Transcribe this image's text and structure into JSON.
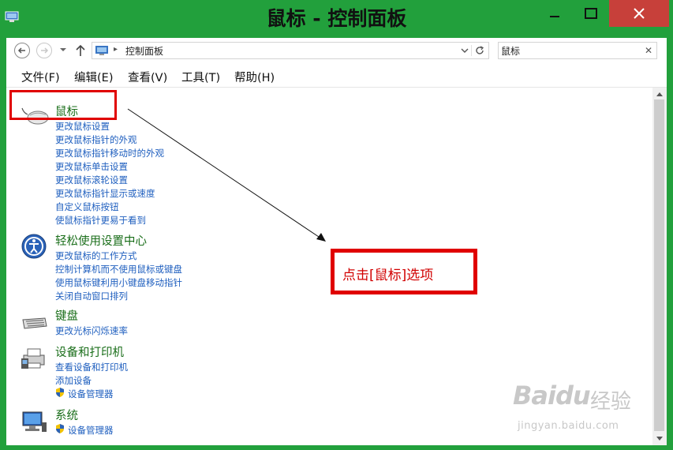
{
  "window": {
    "title": "鼠标 - 控制面板"
  },
  "address": {
    "path": "控制面板"
  },
  "search": {
    "value": "鼠标"
  },
  "menu": [
    "文件(F)",
    "编辑(E)",
    "查看(V)",
    "工具(T)",
    "帮助(H)"
  ],
  "results": {
    "mouse": {
      "title": "鼠标",
      "links": [
        "更改鼠标设置",
        "更改鼠标指针的外观",
        "更改鼠标指针移动时的外观",
        "更改鼠标单击设置",
        "更改鼠标滚轮设置",
        "更改鼠标指针显示或速度",
        "自定义鼠标按钮",
        "使鼠标指针更易于看到"
      ]
    },
    "ease": {
      "title": "轻松使用设置中心",
      "links": [
        "更改鼠标的工作方式",
        "控制计算机而不使用鼠标或键盘",
        "使用鼠标键利用小键盘移动指针",
        "关闭自动窗口排列"
      ]
    },
    "keyboard": {
      "title": "键盘",
      "links": [
        "更改光标闪烁速率"
      ]
    },
    "devices": {
      "title": "设备和打印机",
      "links": [
        "查看设备和打印机",
        "添加设备",
        "设备管理器"
      ]
    },
    "system": {
      "title": "系统",
      "links": [
        "设备管理器"
      ]
    }
  },
  "annotation": {
    "text": "点击[鼠标]选项"
  },
  "watermark": {
    "logo": "Baidu",
    "text": "经验",
    "url": "jingyan.baidu.com"
  },
  "colors": {
    "titlebar": "#22a03c",
    "close_button": "#c7403a",
    "link": "#1f5fbf",
    "group_title": "#1a6e1a",
    "annotation": "#e00000"
  }
}
